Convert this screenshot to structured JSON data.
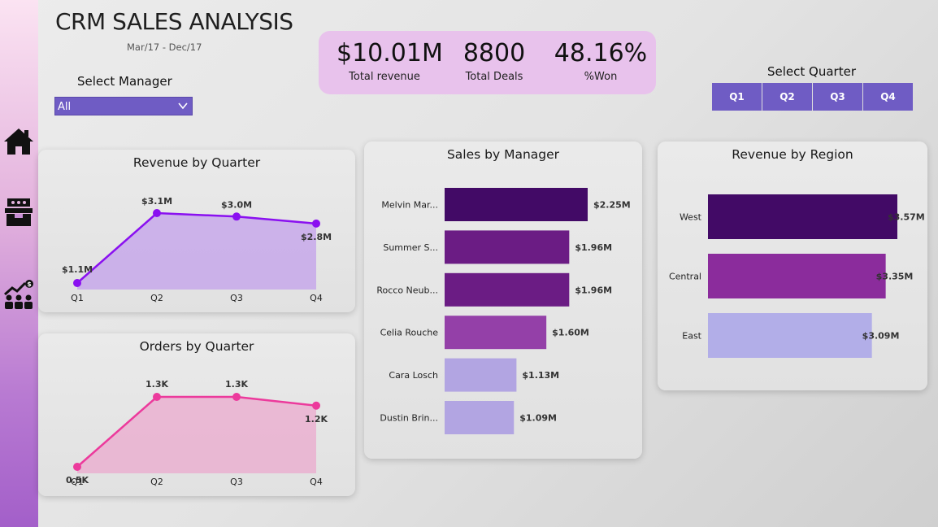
{
  "header": {
    "title": "CRM SALES ANALYSIS",
    "date_range": "Mar/17 - Dec/17"
  },
  "manager_filter": {
    "label": "Select Manager",
    "selected": "All"
  },
  "kpis": [
    {
      "value": "$10.01M",
      "label": "Total revenue"
    },
    {
      "value": "8800",
      "label": "Total Deals"
    },
    {
      "value": "48.16%",
      "label": "%Won"
    }
  ],
  "quarter_filter": {
    "label": "Select Quarter",
    "options": [
      "Q1",
      "Q2",
      "Q3",
      "Q4"
    ]
  },
  "nav": [
    "home-icon",
    "box-icon",
    "sales-team-icon"
  ],
  "colors": {
    "accent": "#6f5cc4",
    "kpi_bg": "#e8c2ec",
    "revenue_line": "#8a10f0",
    "orders_line": "#ec3a9c",
    "manager_bars": [
      "#420a66",
      "#6b1c84",
      "#6b1c84",
      "#9440a8",
      "#b2a5e2",
      "#b2a5e2"
    ],
    "region_bars": [
      "#420a66",
      "#8b2c9c",
      "#b2aee8"
    ]
  },
  "chart_data": [
    {
      "type": "area",
      "title": "Revenue by Quarter",
      "categories": [
        "Q1",
        "Q2",
        "Q3",
        "Q4"
      ],
      "values": [
        1.1,
        3.1,
        3.0,
        2.8
      ],
      "labels": [
        "$1.1M",
        "$3.1M",
        "$3.0M",
        "$2.8M"
      ],
      "ylim": [
        1.1,
        3.1
      ]
    },
    {
      "type": "area",
      "title": "Orders by Quarter",
      "categories": [
        "Q1",
        "Q2",
        "Q3",
        "Q4"
      ],
      "values": [
        0.5,
        1.3,
        1.3,
        1.2
      ],
      "labels": [
        "0.5K",
        "1.3K",
        "1.3K",
        "1.2K"
      ],
      "ylim": [
        0.5,
        1.3
      ]
    },
    {
      "type": "bar",
      "orientation": "horizontal",
      "title": "Sales by Manager",
      "categories": [
        "Melvin Mar...",
        "Summer S...",
        "Rocco Neub...",
        "Celia Rouche",
        "Cara Losch",
        "Dustin Brin..."
      ],
      "values": [
        2.25,
        1.96,
        1.96,
        1.6,
        1.13,
        1.09
      ],
      "labels": [
        "$2.25M",
        "$1.96M",
        "$1.96M",
        "$1.60M",
        "$1.13M",
        "$1.09M"
      ]
    },
    {
      "type": "bar",
      "orientation": "horizontal",
      "title": "Revenue by Region",
      "categories": [
        "West",
        "Central",
        "East"
      ],
      "values": [
        3.57,
        3.35,
        3.09
      ],
      "labels": [
        "$3.57M",
        "$3.35M",
        "$3.09M"
      ]
    }
  ]
}
